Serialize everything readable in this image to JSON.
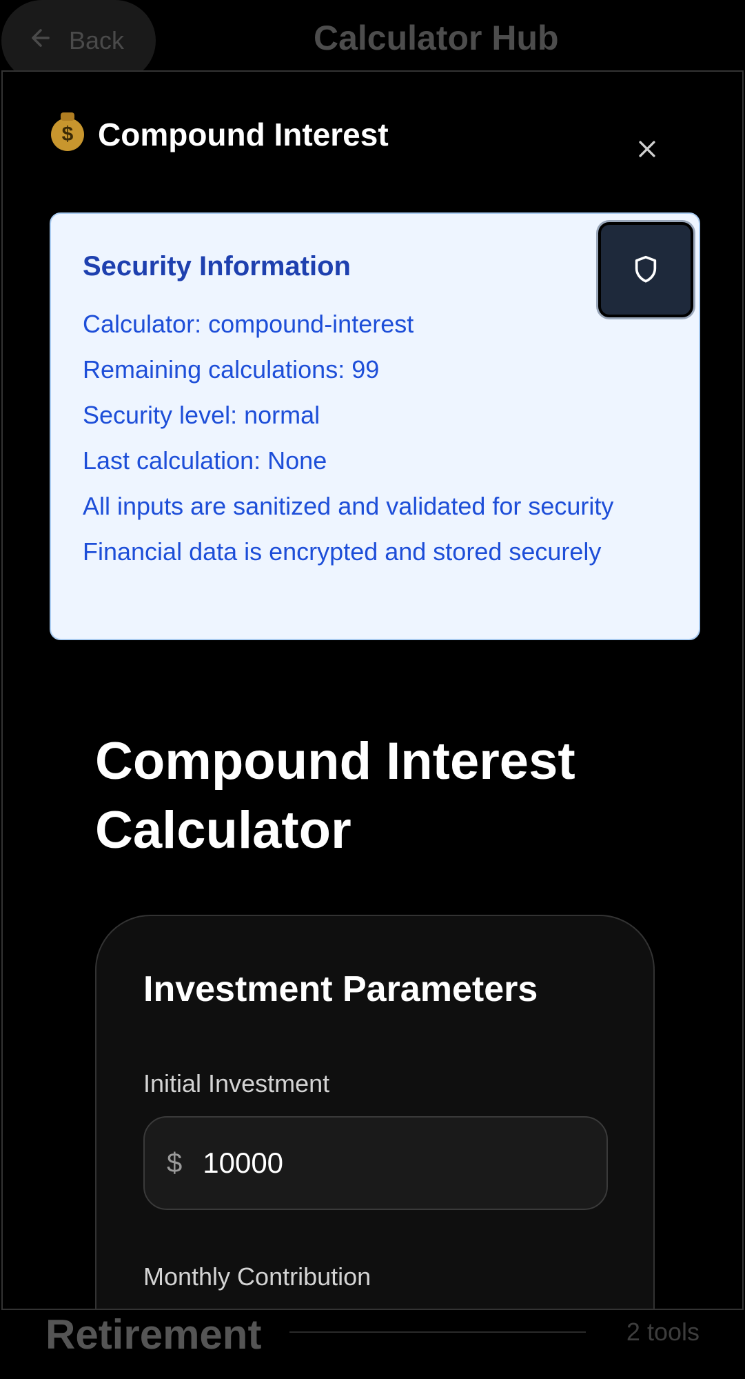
{
  "background": {
    "back_label": "Back",
    "hub_title": "Calculator Hub",
    "section_title": "Retirement",
    "section_count": "2 tools"
  },
  "modal": {
    "icon": "money-bag-icon",
    "title": "Compound Interest",
    "security": {
      "title": "Security Information",
      "lines": [
        "Calculator: compound-interest",
        "Remaining calculations: 99",
        "Security level: normal",
        "Last calculation: None",
        "All inputs are sanitized and validated for security",
        "Financial data is encrypted and stored securely"
      ]
    },
    "calculator_title": "Compound Interest Calculator",
    "params": {
      "title": "Investment Parameters",
      "initial_label": "Initial Investment",
      "currency": "$",
      "initial_value": "10000",
      "monthly_label": "Monthly Contribution"
    }
  },
  "colors": {
    "security_bg": "#eef5ff",
    "security_text": "#1d4ed8",
    "security_title": "#1e40af",
    "shield_button": "#1e293b"
  }
}
